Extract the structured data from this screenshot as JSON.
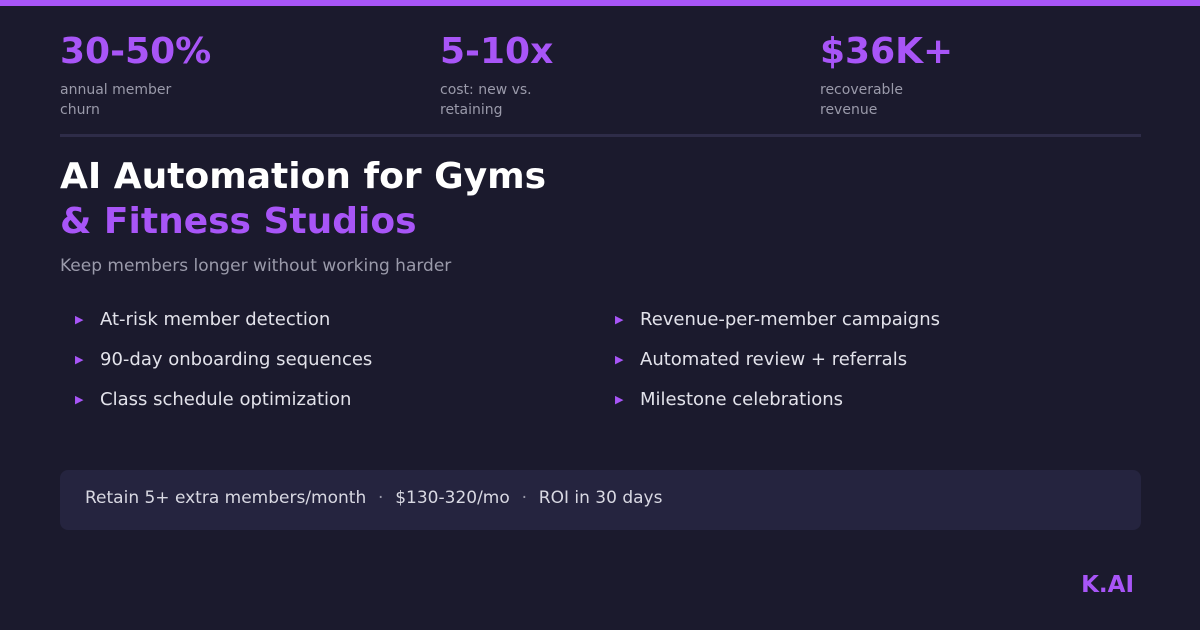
{
  "colors": {
    "background": "#1b1a2d",
    "accent": "#a855f7",
    "text_primary": "#ffffff",
    "text_muted": "#9a9aaa",
    "banner_background": "#25243f"
  },
  "stats": [
    {
      "value": "30-50%",
      "label": "annual member churn"
    },
    {
      "value": "5-10x",
      "label": "cost: new vs. retaining"
    },
    {
      "value": "$36K+",
      "label": "recoverable revenue"
    }
  ],
  "title": {
    "line1": "AI Automation for Gyms",
    "line2": "& Fitness Studios"
  },
  "subtitle": "Keep members longer without working harder",
  "bullet_icon": "triangle-right-icon",
  "bullet_glyph": "▶",
  "features_left": [
    "At-risk member detection",
    "90-day onboarding sequences",
    "Class schedule optimization"
  ],
  "features_right": [
    "Revenue-per-member campaigns",
    "Automated review + referrals",
    "Milestone celebrations"
  ],
  "banner": {
    "items": [
      "Retain 5+ extra members/month",
      "$130-320/mo",
      "ROI in 30 days"
    ],
    "separator": "·"
  },
  "brand": "K.AI"
}
